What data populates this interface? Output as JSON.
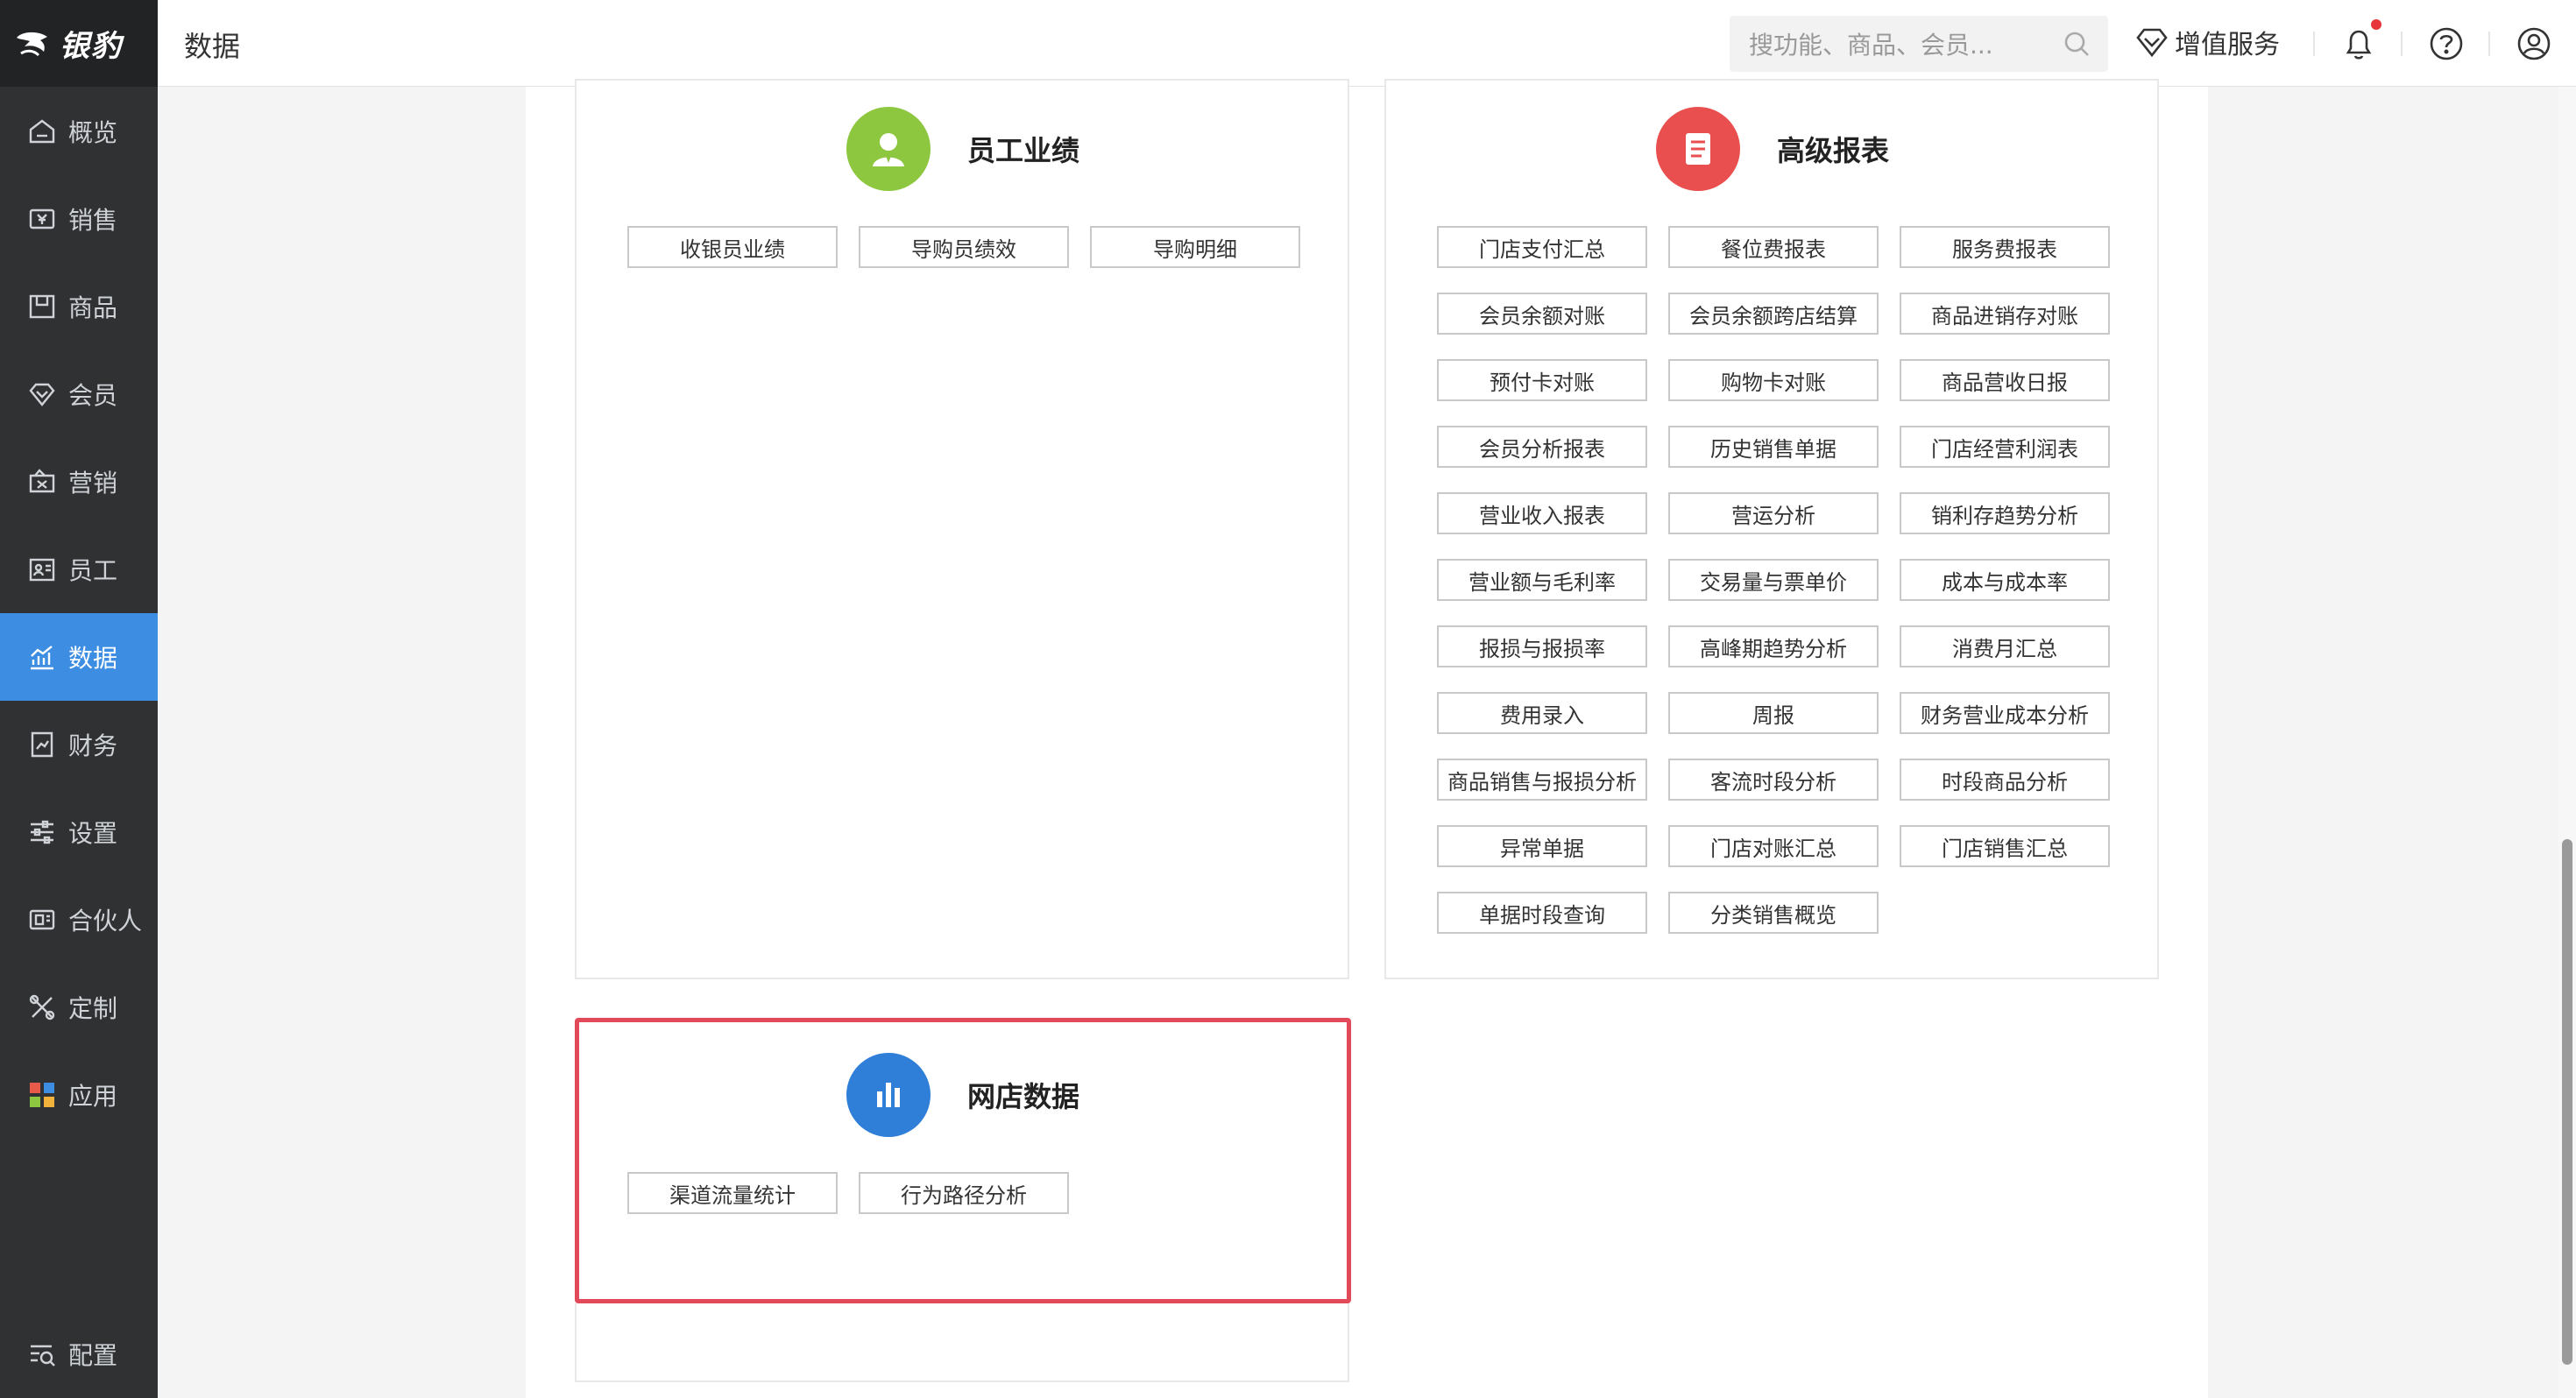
{
  "brand": {
    "name": "银豹"
  },
  "header": {
    "title": "数据",
    "search_placeholder": "搜功能、商品、会员...",
    "vas_label": "增值服务"
  },
  "sidebar": {
    "items": [
      {
        "label": "概览"
      },
      {
        "label": "销售"
      },
      {
        "label": "商品"
      },
      {
        "label": "会员"
      },
      {
        "label": "营销"
      },
      {
        "label": "员工"
      },
      {
        "label": "数据"
      },
      {
        "label": "财务"
      },
      {
        "label": "设置"
      },
      {
        "label": "合伙人"
      },
      {
        "label": "定制"
      },
      {
        "label": "应用"
      }
    ],
    "bottom": {
      "label": "配置"
    }
  },
  "colors": {
    "active_nav": "#3d8de2",
    "staff_icon": "#8dc63f",
    "report_icon": "#ea4f4f",
    "online_icon": "#2f7ed8",
    "highlight_border": "#e24a5a"
  },
  "staff_card": {
    "title": "员工业绩",
    "icon": "user-icon",
    "buttons": [
      "收银员业绩",
      "导购员绩效",
      "导购明细"
    ]
  },
  "report_card": {
    "title": "高级报表",
    "icon": "document-icon",
    "buttons": [
      "门店支付汇总",
      "餐位费报表",
      "服务费报表",
      "会员余额对账",
      "会员余额跨店结算",
      "商品进销存对账",
      "预付卡对账",
      "购物卡对账",
      "商品营收日报",
      "会员分析报表",
      "历史销售单据",
      "门店经营利润表",
      "营业收入报表",
      "营运分析",
      "销利存趋势分析",
      "营业额与毛利率",
      "交易量与票单价",
      "成本与成本率",
      "报损与报损率",
      "高峰期趋势分析",
      "消费月汇总",
      "费用录入",
      "周报",
      "财务营业成本分析",
      "商品销售与报损分析",
      "客流时段分析",
      "时段商品分析",
      "异常单据",
      "门店对账汇总",
      "门店销售汇总",
      "单据时段查询",
      "分类销售概览"
    ]
  },
  "online_card": {
    "title": "网店数据",
    "icon": "bar-chart-icon",
    "buttons": [
      "渠道流量统计",
      "行为路径分析"
    ]
  }
}
